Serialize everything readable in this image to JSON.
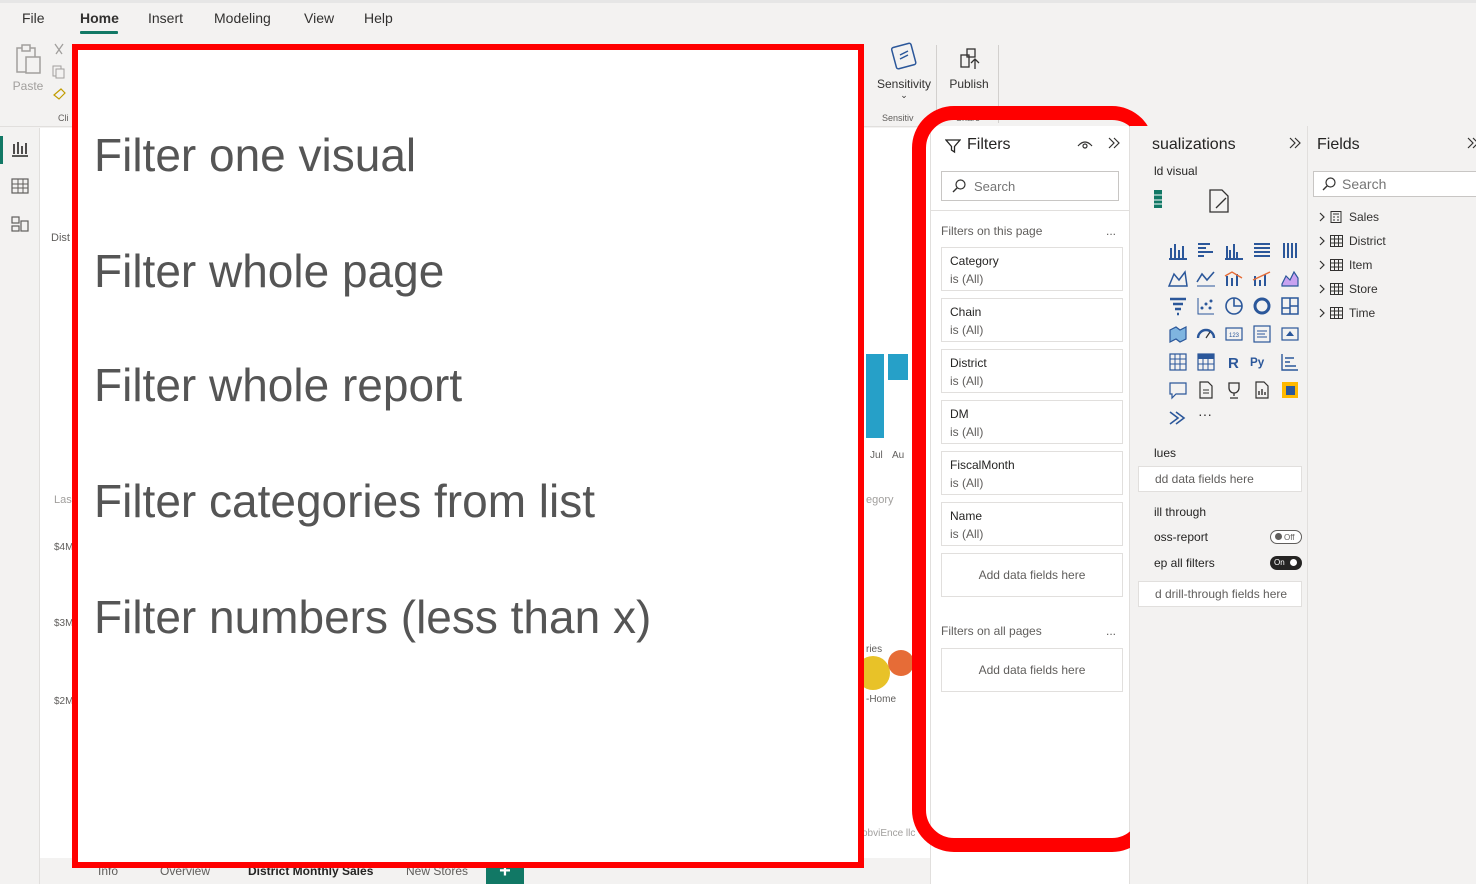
{
  "menu": {
    "items": [
      "File",
      "Home",
      "Insert",
      "Modeling",
      "View",
      "Help"
    ],
    "active": "Home"
  },
  "ribbon": {
    "paste": "Paste",
    "clipboard_group": "Cli",
    "sensitivity": "Sensitivity",
    "sensitivity_group": "Sensitiv",
    "publish": "Publish",
    "share_group": "Share"
  },
  "canvas_fragments": {
    "dist": "Dist",
    "las": "Las",
    "y1": "$4M",
    "y2": "$3M",
    "y3": "$2M",
    "jul": "Jul",
    "aug": "Au",
    "egory": "egory",
    "ries": "ries",
    "home": "-Home",
    "obvi": "obviEnce llc"
  },
  "overlay": {
    "lines": [
      "Filter one visual",
      "Filter whole page",
      "Filter whole report",
      "Filter categories from list",
      "Filter numbers (less than x)"
    ]
  },
  "filters": {
    "title": "Filters",
    "search_placeholder": "Search",
    "section_page": "Filters on this page",
    "section_all": "Filters on all pages",
    "more": "...",
    "cards": [
      {
        "name": "Category",
        "value": "is (All)"
      },
      {
        "name": "Chain",
        "value": "is (All)"
      },
      {
        "name": "District",
        "value": "is (All)"
      },
      {
        "name": "DM",
        "value": "is (All)"
      },
      {
        "name": "FiscalMonth",
        "value": "is (All)"
      },
      {
        "name": "Name",
        "value": "is (All)"
      }
    ],
    "add_fields": "Add data fields here"
  },
  "visualizations": {
    "title": "sualizations",
    "subtitle": "ld visual",
    "values_label": "lues",
    "values_box": "dd data fields here",
    "drill_label": "ill through",
    "cross_report": "oss-report",
    "cross_report_toggle": "Off",
    "keep_filters": "ep all filters",
    "keep_filters_toggle": "On",
    "drill_box": "d drill-through fields here"
  },
  "fields": {
    "title": "Fields",
    "search_placeholder": "Search",
    "tables": [
      "Sales",
      "District",
      "Item",
      "Store",
      "Time"
    ]
  },
  "tabs": {
    "items": [
      "Info",
      "Overview",
      "District Monthly Sales",
      "New Stores"
    ],
    "active": "District Monthly Sales",
    "add": "+"
  }
}
